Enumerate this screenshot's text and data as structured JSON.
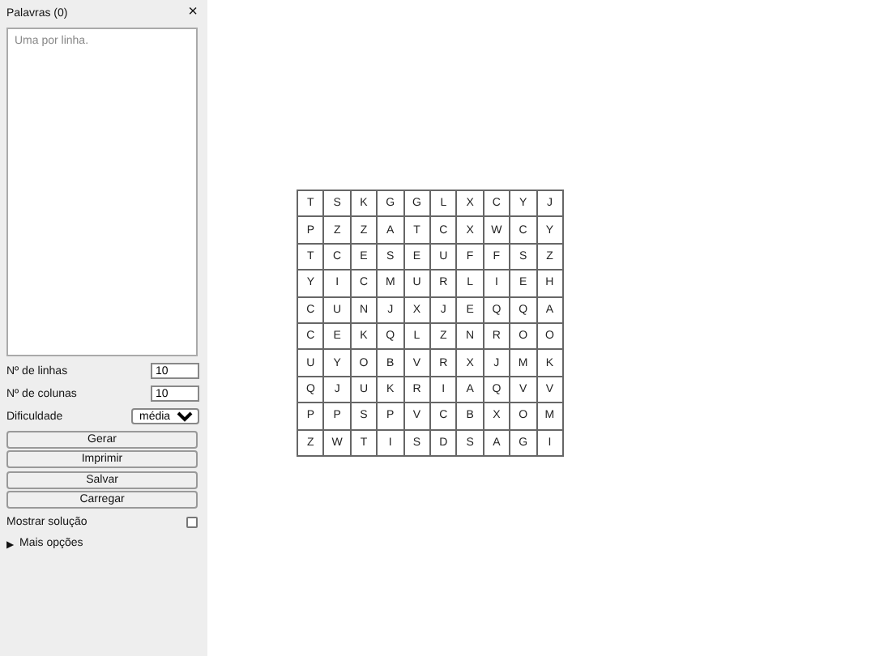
{
  "sidebar": {
    "title": "Palavras (0)",
    "close": "×",
    "words_placeholder": "Uma por linha.",
    "fields": [
      {
        "label": "Nº de linhas",
        "value": "10"
      },
      {
        "label": "Nº de colunas",
        "value": "10"
      }
    ],
    "difficulty": {
      "label": "Dificuldade",
      "value": "média"
    },
    "buttons": [
      "Gerar",
      "Imprimir",
      "Salvar",
      "Carregar"
    ],
    "show_solution": {
      "label": "Mostrar solução",
      "checked": false
    },
    "more_options": {
      "marker": "▶",
      "label": "Mais opções",
      "expanded": false
    }
  },
  "grid": [
    [
      "T",
      "S",
      "K",
      "G",
      "G",
      "L",
      "X",
      "C",
      "Y",
      "J"
    ],
    [
      "P",
      "Z",
      "Z",
      "A",
      "T",
      "C",
      "X",
      "W",
      "C",
      "Y"
    ],
    [
      "T",
      "C",
      "E",
      "S",
      "E",
      "U",
      "F",
      "F",
      "S",
      "Z"
    ],
    [
      "Y",
      "I",
      "C",
      "M",
      "U",
      "R",
      "L",
      "I",
      "E",
      "H"
    ],
    [
      "C",
      "U",
      "N",
      "J",
      "X",
      "J",
      "E",
      "Q",
      "Q",
      "A"
    ],
    [
      "C",
      "E",
      "K",
      "Q",
      "L",
      "Z",
      "N",
      "R",
      "O",
      "O"
    ],
    [
      "U",
      "Y",
      "O",
      "B",
      "V",
      "R",
      "X",
      "J",
      "M",
      "K"
    ],
    [
      "Q",
      "J",
      "U",
      "K",
      "R",
      "I",
      "A",
      "Q",
      "V",
      "V"
    ],
    [
      "P",
      "P",
      "S",
      "P",
      "V",
      "C",
      "B",
      "X",
      "O",
      "M"
    ],
    [
      "Z",
      "W",
      "T",
      "I",
      "S",
      "D",
      "S",
      "A",
      "G",
      "I"
    ]
  ]
}
